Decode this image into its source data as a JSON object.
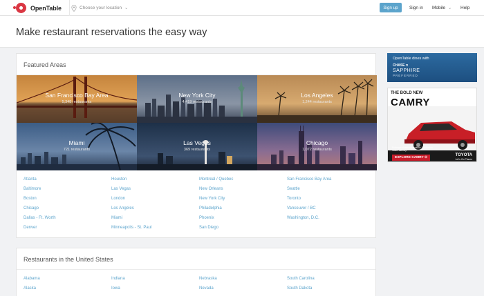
{
  "header": {
    "brand": "OpenTable",
    "location_placeholder": "Choose your location",
    "signup": "Sign up",
    "signin": "Sign in",
    "mobile": "Mobile",
    "help": "Help"
  },
  "hero": {
    "title": "Make restaurant reservations the easy way"
  },
  "featured": {
    "title": "Featured Areas",
    "tiles": [
      {
        "name": "San Francisco Bay Area",
        "count": "5,348 restaurants"
      },
      {
        "name": "New York City",
        "count": "4,419 restaurants"
      },
      {
        "name": "Los Angeles",
        "count": "1,244 restaurants"
      },
      {
        "name": "Miami",
        "count": "721 restaurants"
      },
      {
        "name": "Las Vegas",
        "count": "369 restaurants"
      },
      {
        "name": "Chicago",
        "count": "1,072 restaurants"
      }
    ],
    "links": [
      [
        "Atlanta",
        "Baltimore",
        "Boston",
        "Chicago",
        "Dallas - Ft. Worth",
        "Denver"
      ],
      [
        "Houston",
        "Las Vegas",
        "London",
        "Los Angeles",
        "Miami",
        "Minneapolis - St. Paul"
      ],
      [
        "Montreal / Quebec",
        "New Orleans",
        "New York City",
        "Philadelphia",
        "Phoenix",
        "San Diego"
      ],
      [
        "San Francisco Bay Area",
        "Seattle",
        "Toronto",
        "Vancouver / BC",
        "Washington, D.C."
      ]
    ]
  },
  "us": {
    "title": "Restaurants in the United States",
    "links": [
      [
        "Alabama",
        "Alaska"
      ],
      [
        "Indiana",
        "Iowa"
      ],
      [
        "Nebraska",
        "Nevada"
      ],
      [
        "South Carolina",
        "South Dakota"
      ]
    ]
  },
  "ads": {
    "chase": {
      "line1": "OpenTable dines with",
      "line2": "CHASE ◘",
      "line3": "SAPPHIRE",
      "line4": "PREFERRED"
    },
    "toyota": {
      "line1": "THE BOLD NEW",
      "line2": "CAMRY",
      "fine": "Prototype shown with options. Production model will vary.",
      "cta": "EXPLORE CAMRY ⊙",
      "brand": "TOYOTA",
      "tagline": "Let's Go Places"
    }
  },
  "colors": {
    "brand_red": "#da3743",
    "link_blue": "#5ca4cc",
    "signup_bg": "#5ca4cc"
  }
}
